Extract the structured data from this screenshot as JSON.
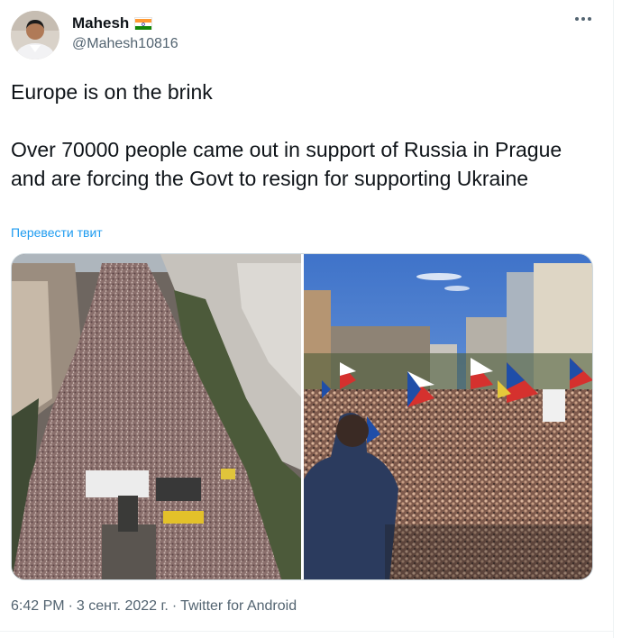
{
  "author": {
    "display_name": "Mahesh",
    "handle": "@Mahesh10816",
    "avatar_icon": "avatar-photo",
    "flag_icon": "india-flag-emoji"
  },
  "tweet": {
    "text": "Europe is on the brink\n\nOver 70000 people came out in support of Russia in Prague and are forcing the Govt to resign for supporting Ukraine",
    "translate_label": "Перевести твит"
  },
  "media": {
    "photo_count": 2
  },
  "meta": {
    "time": "6:42 PM",
    "separator": "·",
    "date": "3 сент. 2022 г.",
    "source": "Twitter for Android"
  },
  "colors": {
    "link": "#1d9bf0",
    "secondary_text": "#536471",
    "primary_text": "#0f1419"
  },
  "icons": {
    "more": "more-horizontal-icon"
  }
}
